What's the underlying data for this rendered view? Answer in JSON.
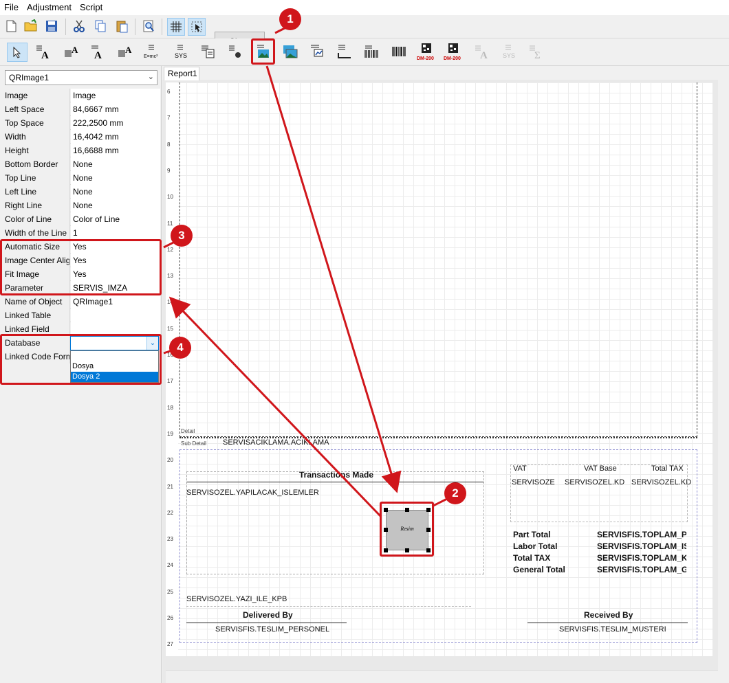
{
  "menu": [
    "File",
    "Adjustment",
    "Script"
  ],
  "toolbar": {
    "close_label": "Close",
    "icons": [
      "new-file-icon",
      "open-folder-icon",
      "save-icon",
      "cut-icon",
      "copy-icon",
      "paste-icon",
      "preview-icon",
      "grid-icon",
      "select-icon"
    ]
  },
  "components_toolbar": {
    "icons": [
      "pointer-icon",
      "text-label-icon",
      "db-text-icon",
      "rich-text-icon",
      "db-rich-text-icon",
      "expression-icon",
      "system-data-icon",
      "memo-icon",
      "shape-icon",
      "image-icon",
      "db-image-icon",
      "chart-icon",
      "line-icon",
      "barcode-icon",
      "db-barcode-icon",
      "qrcode-icon",
      "db-qrcode-icon",
      "disabled-text-icon",
      "disabled-sys-icon",
      "disabled-sum-icon"
    ],
    "barcode_tag1": "DM-200",
    "barcode_tag2": "DM-200",
    "expr_label": "E=mc²",
    "sys_label": "SYS",
    "sys_label2": "SYS"
  },
  "object_selector": "QRImage1",
  "properties": [
    {
      "name": "Image",
      "value": "Image"
    },
    {
      "name": "Left Space",
      "value": "84,6667 mm"
    },
    {
      "name": "Top Space",
      "value": "222,2500 mm"
    },
    {
      "name": "Width",
      "value": "16,4042 mm"
    },
    {
      "name": "Height",
      "value": "16,6688 mm"
    },
    {
      "name": "Bottom Border",
      "value": "None"
    },
    {
      "name": "Top Line",
      "value": "None"
    },
    {
      "name": "Left Line",
      "value": "None"
    },
    {
      "name": "Right Line",
      "value": "None"
    },
    {
      "name": "Color of Line",
      "value": "Color of Line"
    },
    {
      "name": "Width of the Line",
      "value": "1"
    },
    {
      "name": "Automatic Size",
      "value": "Yes"
    },
    {
      "name": "Image Center Alignment",
      "value": "Yes"
    },
    {
      "name": "Fit Image",
      "value": "Yes"
    },
    {
      "name": "Parameter",
      "value": "SERVIS_IMZA"
    },
    {
      "name": "Name of Object",
      "value": "QRImage1"
    },
    {
      "name": "Linked Table",
      "value": ""
    },
    {
      "name": "Linked Field",
      "value": ""
    },
    {
      "name": "Database",
      "value": ""
    },
    {
      "name": "Linked Code Format",
      "value": ""
    }
  ],
  "database_options": [
    "Dosya",
    "Dosya 2"
  ],
  "database_selected": "Dosya 2",
  "report_tab": "Report1",
  "ruler_numbers": [
    "6",
    "7",
    "8",
    "9",
    "10",
    "11",
    "12",
    "13",
    "14",
    "15",
    "16",
    "17",
    "18",
    "19",
    "20",
    "21",
    "22",
    "23",
    "24",
    "25",
    "26",
    "27"
  ],
  "report": {
    "detail_label": "Detail",
    "subdetail_label": "Sub Detail",
    "servis_aciklama": "SERVISACIKLAMA.ACIKLAMA",
    "transactions_title": "Transactions Made",
    "yapilacak": "SERVISOZEL.YAPILACAK_ISLEMLER",
    "vat_header": "VAT",
    "vat_base_header": "VAT Base",
    "total_tax_header": "Total TAX",
    "vat_field": "SERVISOZE",
    "vat_base_field": "SERVISOZEL.KD",
    "total_tax_field": "SERVISOZEL.KD",
    "image_placeholder": "Resim",
    "totals": [
      {
        "label": "Part Total",
        "field": "SERVISFIS.TOPLAM_PAR"
      },
      {
        "label": "Labor Total",
        "field": "SERVISFIS.TOPLAM_ISC"
      },
      {
        "label": "Total TAX",
        "field": "SERVISFIS.TOPLAM_KDV"
      },
      {
        "label": "General Total",
        "field": "SERVISFIS.TOPLAM_GEN"
      }
    ],
    "yazi_ile": "SERVISOZEL.YAZI_ILE_KPB",
    "delivered_by": "Delivered By",
    "teslim_personel": "SERVISFIS.TESLIM_PERSONEL",
    "received_by": "Received By",
    "teslim_musteri": "SERVISFIS.TESLIM_MUSTERI"
  },
  "callouts": [
    "1",
    "2",
    "3",
    "4"
  ],
  "colors": {
    "callout": "#d0161b",
    "selection": "#0078d7"
  }
}
